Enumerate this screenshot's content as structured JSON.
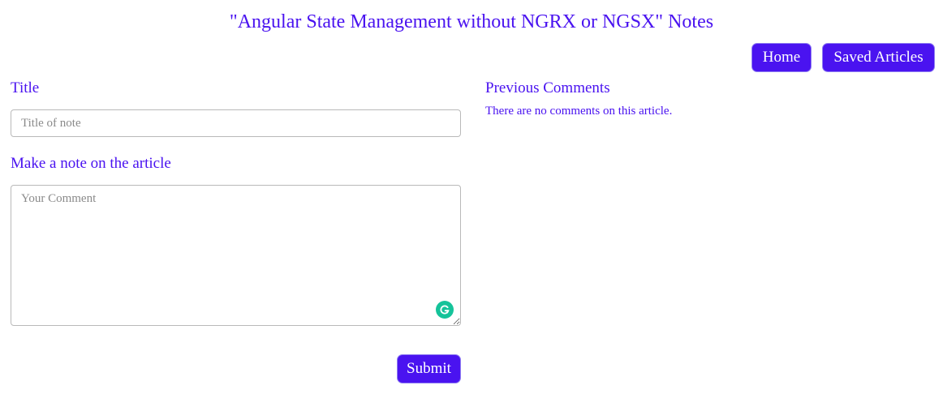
{
  "page": {
    "title": "\"Angular State Management without NGRX or NGSX\" Notes"
  },
  "nav": {
    "home_label": "Home",
    "saved_articles_label": "Saved Articles"
  },
  "note_form": {
    "title_label": "Title",
    "title_placeholder": "Title of note",
    "title_value": "",
    "note_label": "Make a note on the article",
    "comment_placeholder": "Your Comment",
    "comment_value": "",
    "submit_label": "Submit"
  },
  "comments_panel": {
    "heading": "Previous Comments",
    "empty_message": "There are no comments on this article."
  },
  "icons": {
    "grammarly": "grammarly-icon"
  },
  "colors": {
    "accent": "#4a13f0",
    "grammarly": "#15c39a"
  }
}
